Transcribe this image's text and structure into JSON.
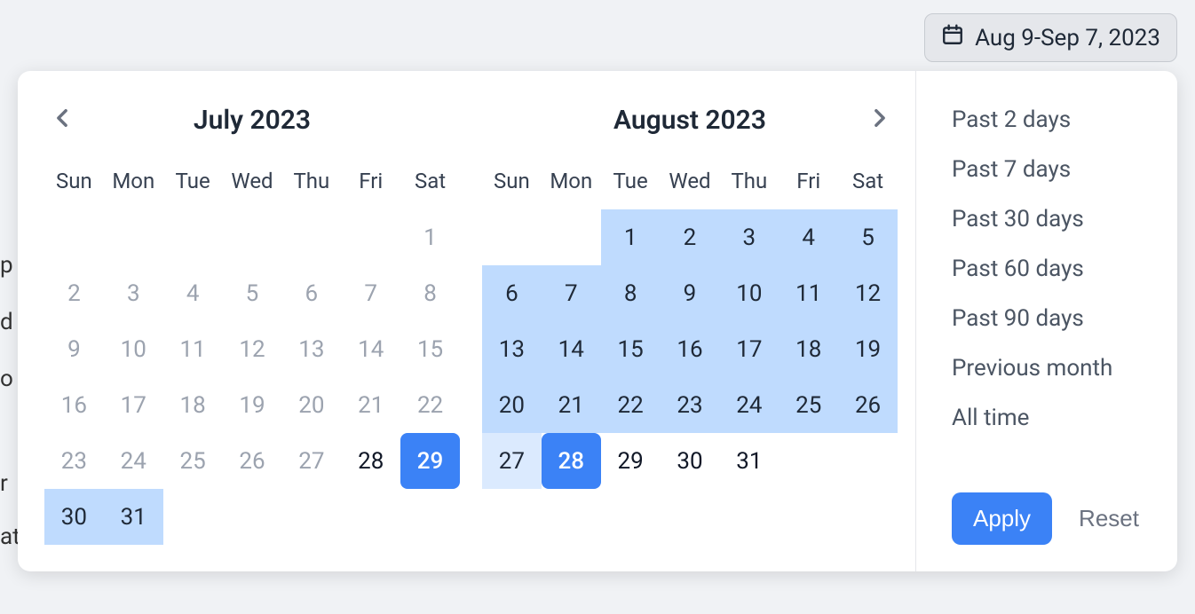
{
  "background_fragments": [
    "p",
    "d i",
    "o",
    "r",
    "at"
  ],
  "trigger": {
    "label": "Aug 9-Sep 7, 2023"
  },
  "dow": [
    "Sun",
    "Mon",
    "Tue",
    "Wed",
    "Thu",
    "Fri",
    "Sat"
  ],
  "months": [
    {
      "title": "July 2023",
      "nav": "left",
      "weeks": [
        [
          {
            "t": "",
            "c": "empty"
          },
          {
            "t": "",
            "c": "empty"
          },
          {
            "t": "",
            "c": "empty"
          },
          {
            "t": "",
            "c": "empty"
          },
          {
            "t": "",
            "c": "empty"
          },
          {
            "t": "",
            "c": "empty"
          },
          {
            "t": "1",
            "c": "muted"
          }
        ],
        [
          {
            "t": "2",
            "c": "muted"
          },
          {
            "t": "3",
            "c": "muted"
          },
          {
            "t": "4",
            "c": "muted"
          },
          {
            "t": "5",
            "c": "muted"
          },
          {
            "t": "6",
            "c": "muted"
          },
          {
            "t": "7",
            "c": "muted"
          },
          {
            "t": "8",
            "c": "muted"
          }
        ],
        [
          {
            "t": "9",
            "c": "muted"
          },
          {
            "t": "10",
            "c": "muted"
          },
          {
            "t": "11",
            "c": "muted"
          },
          {
            "t": "12",
            "c": "muted"
          },
          {
            "t": "13",
            "c": "muted"
          },
          {
            "t": "14",
            "c": "muted"
          },
          {
            "t": "15",
            "c": "muted"
          }
        ],
        [
          {
            "t": "16",
            "c": "muted"
          },
          {
            "t": "17",
            "c": "muted"
          },
          {
            "t": "18",
            "c": "muted"
          },
          {
            "t": "19",
            "c": "muted"
          },
          {
            "t": "20",
            "c": "muted"
          },
          {
            "t": "21",
            "c": "muted"
          },
          {
            "t": "22",
            "c": "muted"
          }
        ],
        [
          {
            "t": "23",
            "c": "muted"
          },
          {
            "t": "24",
            "c": "muted"
          },
          {
            "t": "25",
            "c": "muted"
          },
          {
            "t": "26",
            "c": "muted"
          },
          {
            "t": "27",
            "c": "muted"
          },
          {
            "t": "28",
            "c": "normal"
          },
          {
            "t": "29",
            "c": "sel"
          }
        ],
        [
          {
            "t": "30",
            "c": "range"
          },
          {
            "t": "31",
            "c": "range"
          },
          {
            "t": "",
            "c": "empty"
          },
          {
            "t": "",
            "c": "empty"
          },
          {
            "t": "",
            "c": "empty"
          },
          {
            "t": "",
            "c": "empty"
          },
          {
            "t": "",
            "c": "empty"
          }
        ]
      ]
    },
    {
      "title": "August 2023",
      "nav": "right",
      "weeks": [
        [
          {
            "t": "",
            "c": "empty"
          },
          {
            "t": "",
            "c": "empty"
          },
          {
            "t": "1",
            "c": "range"
          },
          {
            "t": "2",
            "c": "range"
          },
          {
            "t": "3",
            "c": "range"
          },
          {
            "t": "4",
            "c": "range"
          },
          {
            "t": "5",
            "c": "range"
          }
        ],
        [
          {
            "t": "6",
            "c": "range"
          },
          {
            "t": "7",
            "c": "range"
          },
          {
            "t": "8",
            "c": "range"
          },
          {
            "t": "9",
            "c": "range"
          },
          {
            "t": "10",
            "c": "range"
          },
          {
            "t": "11",
            "c": "range"
          },
          {
            "t": "12",
            "c": "range"
          }
        ],
        [
          {
            "t": "13",
            "c": "range"
          },
          {
            "t": "14",
            "c": "range"
          },
          {
            "t": "15",
            "c": "range"
          },
          {
            "t": "16",
            "c": "range"
          },
          {
            "t": "17",
            "c": "range"
          },
          {
            "t": "18",
            "c": "range"
          },
          {
            "t": "19",
            "c": "range"
          }
        ],
        [
          {
            "t": "20",
            "c": "range"
          },
          {
            "t": "21",
            "c": "range"
          },
          {
            "t": "22",
            "c": "range"
          },
          {
            "t": "23",
            "c": "range"
          },
          {
            "t": "24",
            "c": "range"
          },
          {
            "t": "25",
            "c": "range"
          },
          {
            "t": "26",
            "c": "range"
          }
        ],
        [
          {
            "t": "27",
            "c": "range-light"
          },
          {
            "t": "28",
            "c": "sel"
          },
          {
            "t": "29",
            "c": "normal"
          },
          {
            "t": "30",
            "c": "normal"
          },
          {
            "t": "31",
            "c": "normal"
          },
          {
            "t": "",
            "c": "empty"
          },
          {
            "t": "",
            "c": "empty"
          }
        ]
      ]
    }
  ],
  "presets": [
    "Past 2 days",
    "Past 7 days",
    "Past 30 days",
    "Past 60 days",
    "Past 90 days",
    "Previous month",
    "All time"
  ],
  "actions": {
    "apply": "Apply",
    "reset": "Reset"
  }
}
